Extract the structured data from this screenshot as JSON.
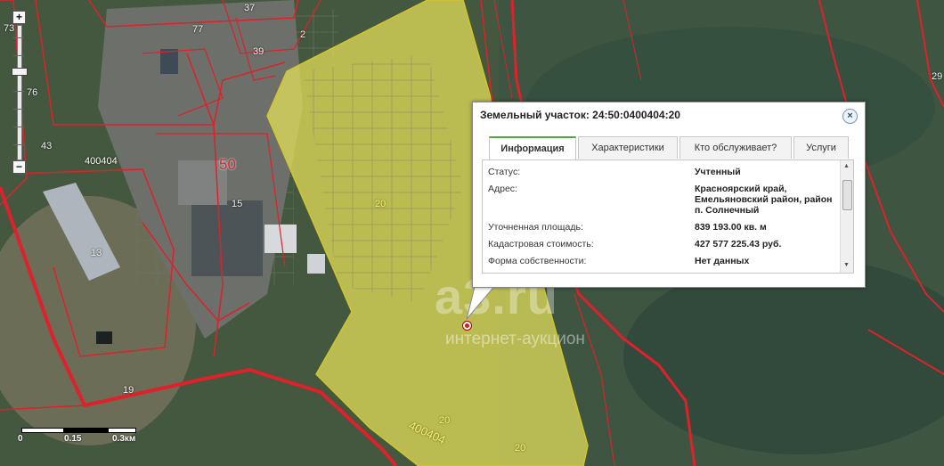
{
  "map": {
    "labels": {
      "p73": "73",
      "p76": "76",
      "p43": "43",
      "p77": "77",
      "p37": "37",
      "p39": "39",
      "p2": "2",
      "p50": "50",
      "p15": "15",
      "p13": "13",
      "p20a": "20",
      "p20b": "20",
      "p20c": "20",
      "p19": "19",
      "p29": "29",
      "code_left": "400404",
      "code_bottom": "400404"
    },
    "scale": {
      "l0": "0",
      "l1": "0.15",
      "l2": "0.3км"
    },
    "watermark": {
      "brand": "a3.ru",
      "tagline": "интернет-аукцион"
    }
  },
  "zoom": {
    "plus": "+",
    "minus": "−"
  },
  "popup": {
    "title": "Земельный участок: 24:50:0400404:20",
    "close": "×",
    "tabs": [
      "Информация",
      "Характеристики",
      "Кто обслуживает?",
      "Услуги"
    ],
    "rows": [
      {
        "label": "Статус:",
        "value": "Учтенный"
      },
      {
        "label": "Адрес:",
        "value": "Красноярский край, Емельяновский район, район п. Солнечный"
      },
      {
        "label": "Уточненная площадь:",
        "value": "839 193.00 кв. м"
      },
      {
        "label": "Кадастровая стоимость:",
        "value": "427 577 225.43 руб."
      },
      {
        "label": "Форма собственности:",
        "value": "Нет данных"
      }
    ]
  },
  "colors": {
    "boundary": "#e0202a",
    "highlight": "#e8e35a",
    "tab_accent": "#57a340"
  }
}
